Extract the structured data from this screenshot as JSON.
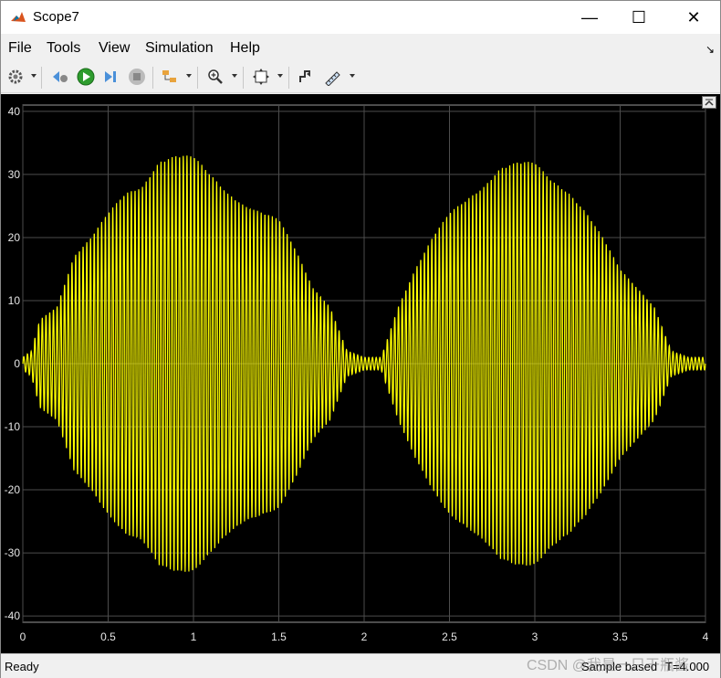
{
  "window": {
    "title": "Scope7",
    "minimize_glyph": "—",
    "maximize_glyph": "☐",
    "close_glyph": "✕"
  },
  "menu": {
    "file": "File",
    "tools": "Tools",
    "view": "View",
    "simulation": "Simulation",
    "help": "Help"
  },
  "toolbar": {
    "icons": [
      "gear-icon",
      "scope-params-icon",
      "run-icon",
      "step-forward-icon",
      "stop-icon",
      "highlight-block-icon",
      "zoom-in-icon",
      "autoscale-icon",
      "triggers-icon",
      "measurements-icon"
    ]
  },
  "colors": {
    "signal": "#ffff00",
    "plot_bg": "#000000",
    "grid": "#4d4d4d",
    "axis_text": "#e6e6e6"
  },
  "chart_data": {
    "type": "line",
    "title": "",
    "xlabel": "",
    "ylabel": "",
    "xlim": [
      0,
      4
    ],
    "ylim": [
      -41,
      41
    ],
    "grid": true,
    "xticks": [
      "0",
      "0.5",
      "1",
      "1.5",
      "2",
      "2.5",
      "3",
      "3.5",
      "4"
    ],
    "yticks": [
      "40",
      "30",
      "20",
      "10",
      "0",
      "-10",
      "-20",
      "-30",
      "-40"
    ],
    "series": [
      {
        "name": "",
        "color": "#ffff00",
        "description_envelope": "amplitude-modulated oscillation, two bursts",
        "envelope_x": [
          0,
          0.05,
          0.1,
          0.2,
          0.3,
          0.4,
          0.5,
          0.6,
          0.7,
          0.8,
          0.9,
          1.0,
          1.1,
          1.2,
          1.3,
          1.4,
          1.5,
          1.6,
          1.7,
          1.8,
          1.9,
          2.0,
          2.1,
          2.2,
          2.3,
          2.4,
          2.5,
          2.6,
          2.7,
          2.8,
          2.9,
          3.0,
          3.1,
          3.2,
          3.3,
          3.4,
          3.5,
          3.6,
          3.7,
          3.8,
          3.9,
          4.0
        ],
        "envelope_y": [
          1,
          2,
          7,
          9,
          17,
          20,
          24,
          27,
          28,
          32,
          33,
          33,
          30,
          27,
          25,
          24,
          23,
          18,
          12,
          9,
          2,
          1,
          1,
          9,
          15,
          20,
          24,
          26,
          28,
          31,
          32,
          32,
          29,
          27,
          24,
          20,
          15,
          12,
          9,
          2,
          1,
          1
        ]
      }
    ]
  },
  "status": {
    "ready": "Ready",
    "mode": "Sample based",
    "time": "T=4.000"
  },
  "watermark": "CSDN @我是一只干瓶酱"
}
